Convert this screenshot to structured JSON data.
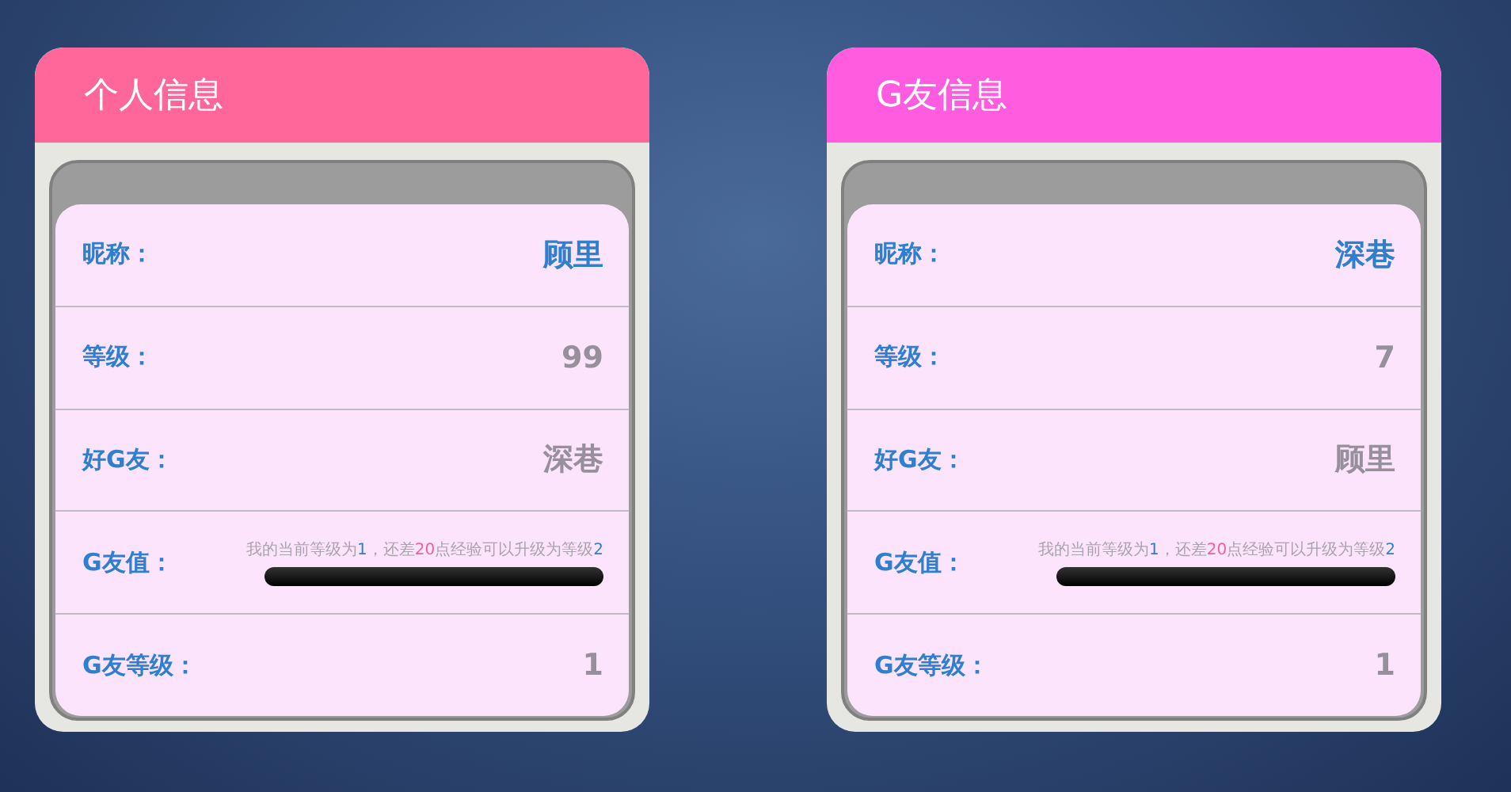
{
  "cards": [
    {
      "title": "个人信息",
      "color": "#ff6699",
      "rows": [
        {
          "kind": "name",
          "label": "昵称：",
          "value": "顾里"
        },
        {
          "kind": "plain",
          "label": "等级：",
          "value": "99"
        },
        {
          "kind": "plain",
          "label": "好G友：",
          "value": "深巷"
        },
        {
          "kind": "progress",
          "label": "G友值：",
          "segments": [
            {
              "kind": "plain",
              "text": "我的当前等级为"
            },
            {
              "kind": "level",
              "text": "1"
            },
            {
              "kind": "plain",
              "text": "，还差"
            },
            {
              "kind": "points",
              "text": "20"
            },
            {
              "kind": "plain",
              "text": "点经验可以升级为等级"
            },
            {
              "kind": "level",
              "text": "2"
            }
          ]
        },
        {
          "kind": "plain",
          "label": "G友等级：",
          "value": "1"
        }
      ]
    },
    {
      "title": "G友信息",
      "color": "#ff5ce0",
      "rows": [
        {
          "kind": "name",
          "label": "昵称：",
          "value": "深巷"
        },
        {
          "kind": "plain",
          "label": "等级：",
          "value": "7"
        },
        {
          "kind": "plain",
          "label": "好G友：",
          "value": "顾里"
        },
        {
          "kind": "progress",
          "label": "G友值：",
          "segments": [
            {
              "kind": "plain",
              "text": "我的当前等级为"
            },
            {
              "kind": "level",
              "text": "1"
            },
            {
              "kind": "plain",
              "text": "，还差"
            },
            {
              "kind": "points",
              "text": "20"
            },
            {
              "kind": "plain",
              "text": "点经验可以升级为等级"
            },
            {
              "kind": "level",
              "text": "2"
            }
          ]
        },
        {
          "kind": "plain",
          "label": "G友等级：",
          "value": "1"
        }
      ]
    }
  ]
}
